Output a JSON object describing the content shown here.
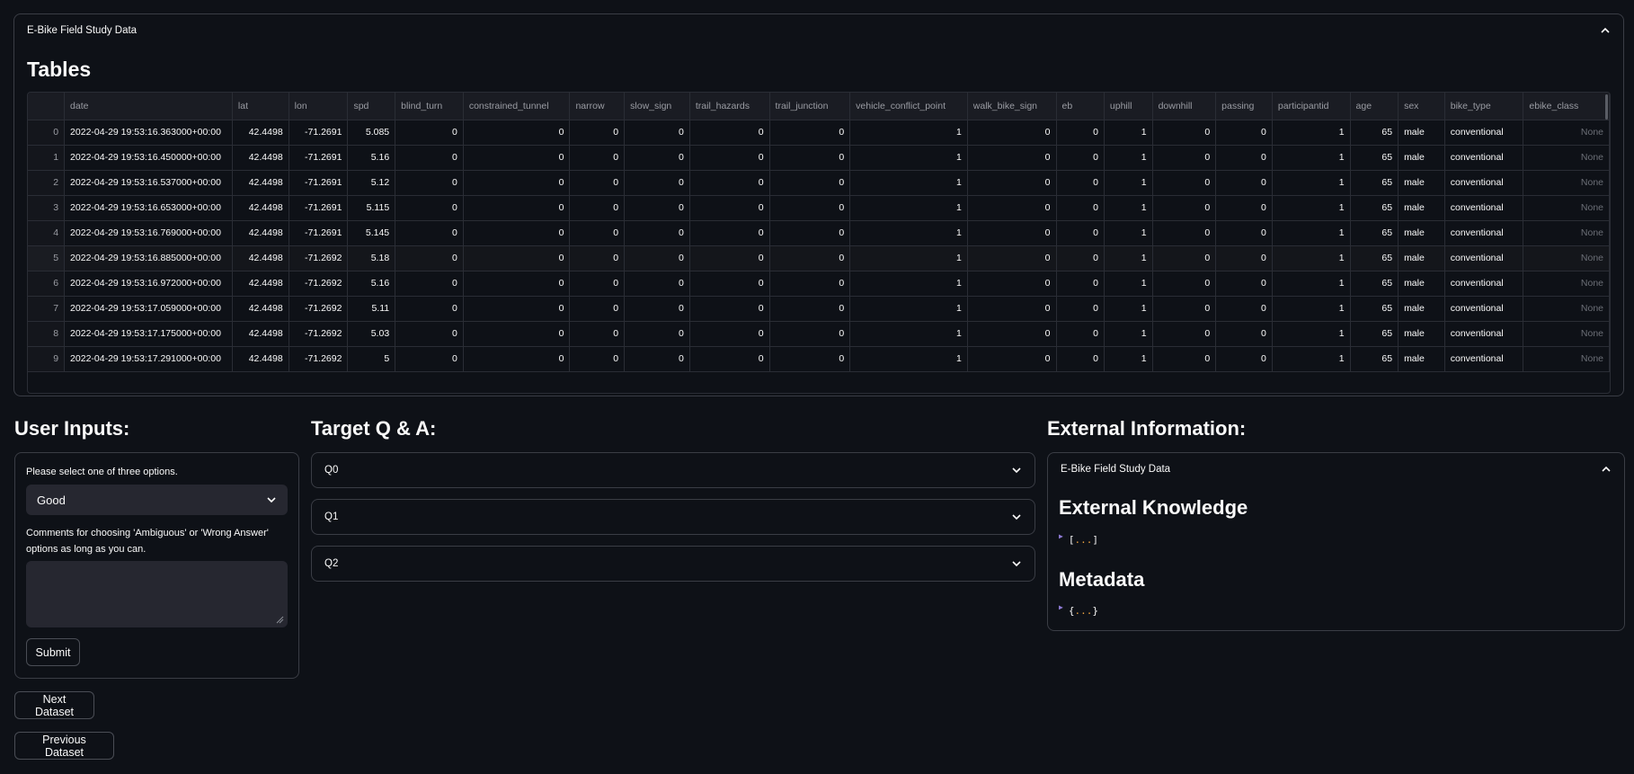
{
  "top_expander": {
    "title": "E-Bike Field Study Data",
    "heading": "Tables"
  },
  "table": {
    "columns": [
      "",
      "date",
      "lat",
      "lon",
      "spd",
      "blind_turn",
      "constrained_tunnel",
      "narrow",
      "slow_sign",
      "trail_hazards",
      "trail_junction",
      "vehicle_conflict_point",
      "walk_bike_sign",
      "eb",
      "uphill",
      "downhill",
      "passing",
      "participantid",
      "age",
      "sex",
      "bike_type",
      "ebike_class"
    ],
    "rows": [
      [
        "0",
        "2022-04-29 19:53:16.363000+00:00",
        "42.4498",
        "-71.2691",
        "5.085",
        "0",
        "0",
        "0",
        "0",
        "0",
        "0",
        "1",
        "0",
        "0",
        "1",
        "0",
        "0",
        "1",
        "65",
        "male",
        "conventional",
        "None"
      ],
      [
        "1",
        "2022-04-29 19:53:16.450000+00:00",
        "42.4498",
        "-71.2691",
        "5.16",
        "0",
        "0",
        "0",
        "0",
        "0",
        "0",
        "1",
        "0",
        "0",
        "1",
        "0",
        "0",
        "1",
        "65",
        "male",
        "conventional",
        "None"
      ],
      [
        "2",
        "2022-04-29 19:53:16.537000+00:00",
        "42.4498",
        "-71.2691",
        "5.12",
        "0",
        "0",
        "0",
        "0",
        "0",
        "0",
        "1",
        "0",
        "0",
        "1",
        "0",
        "0",
        "1",
        "65",
        "male",
        "conventional",
        "None"
      ],
      [
        "3",
        "2022-04-29 19:53:16.653000+00:00",
        "42.4498",
        "-71.2691",
        "5.115",
        "0",
        "0",
        "0",
        "0",
        "0",
        "0",
        "1",
        "0",
        "0",
        "1",
        "0",
        "0",
        "1",
        "65",
        "male",
        "conventional",
        "None"
      ],
      [
        "4",
        "2022-04-29 19:53:16.769000+00:00",
        "42.4498",
        "-71.2691",
        "5.145",
        "0",
        "0",
        "0",
        "0",
        "0",
        "0",
        "1",
        "0",
        "0",
        "1",
        "0",
        "0",
        "1",
        "65",
        "male",
        "conventional",
        "None"
      ],
      [
        "5",
        "2022-04-29 19:53:16.885000+00:00",
        "42.4498",
        "-71.2692",
        "5.18",
        "0",
        "0",
        "0",
        "0",
        "0",
        "0",
        "1",
        "0",
        "0",
        "1",
        "0",
        "0",
        "1",
        "65",
        "male",
        "conventional",
        "None"
      ],
      [
        "6",
        "2022-04-29 19:53:16.972000+00:00",
        "42.4498",
        "-71.2692",
        "5.16",
        "0",
        "0",
        "0",
        "0",
        "0",
        "0",
        "1",
        "0",
        "0",
        "1",
        "0",
        "0",
        "1",
        "65",
        "male",
        "conventional",
        "None"
      ],
      [
        "7",
        "2022-04-29 19:53:17.059000+00:00",
        "42.4498",
        "-71.2692",
        "5.11",
        "0",
        "0",
        "0",
        "0",
        "0",
        "0",
        "1",
        "0",
        "0",
        "1",
        "0",
        "0",
        "1",
        "65",
        "male",
        "conventional",
        "None"
      ],
      [
        "8",
        "2022-04-29 19:53:17.175000+00:00",
        "42.4498",
        "-71.2692",
        "5.03",
        "0",
        "0",
        "0",
        "0",
        "0",
        "0",
        "1",
        "0",
        "0",
        "1",
        "0",
        "0",
        "1",
        "65",
        "male",
        "conventional",
        "None"
      ],
      [
        "9",
        "2022-04-29 19:53:17.291000+00:00",
        "42.4498",
        "-71.2692",
        "5",
        "0",
        "0",
        "0",
        "0",
        "0",
        "0",
        "1",
        "0",
        "0",
        "1",
        "0",
        "0",
        "1",
        "65",
        "male",
        "conventional",
        "None"
      ]
    ]
  },
  "user_inputs": {
    "title": "User Inputs:",
    "select_label": "Please select one of three options.",
    "select_value": "Good",
    "comment_label": "Comments for choosing 'Ambiguous' or 'Wrong Answer' options as long as you can.",
    "comment_value": "",
    "submit_label": "Submit"
  },
  "navigation": {
    "next_label": "Next Dataset",
    "prev_label": "Previous Dataset"
  },
  "target_qa": {
    "title": "Target Q & A:",
    "items": [
      "Q0",
      "Q1",
      "Q2"
    ]
  },
  "external_info": {
    "title": "External Information:",
    "expander_title": "E-Bike Field Study Data",
    "knowledge_heading": "External Knowledge",
    "knowledge_open": "[",
    "knowledge_dots": "...",
    "knowledge_close": "]",
    "metadata_heading": "Metadata",
    "metadata_open": "{",
    "metadata_dots": "...",
    "metadata_close": "}"
  },
  "icons": {
    "expander_open": "chevron-up-icon",
    "expander_closed": "chevron-down-icon",
    "json_toggle": "triangle-right-icon"
  }
}
